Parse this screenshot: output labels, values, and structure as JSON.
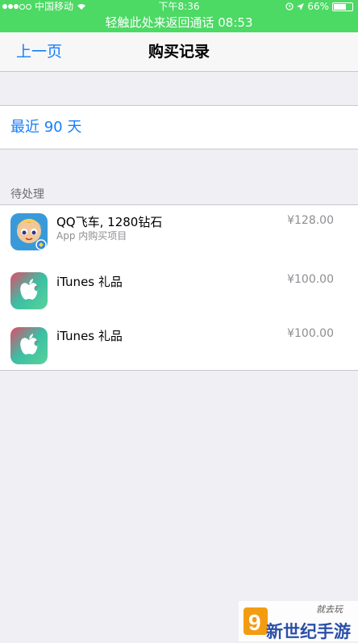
{
  "status_bar": {
    "carrier": "中国移动",
    "time": "下午8:36",
    "battery": "66%",
    "battery_level": 0.66,
    "icons": [
      "signal-dots",
      "wifi-icon",
      "alarm-icon",
      "location-icon",
      "battery-icon"
    ]
  },
  "call_banner": {
    "text": "轻触此处来返回通话 08:53"
  },
  "nav": {
    "back_label": "上一页",
    "title": "购买记录"
  },
  "period": {
    "label": "最近 90 天"
  },
  "pending": {
    "header": "待处理",
    "items": [
      {
        "title": "QQ飞车, 1280钻石",
        "subtitle": "App 内购买项目",
        "price": "¥128.00",
        "icon": "qq-speed-game-icon"
      },
      {
        "title": "iTunes 礼品",
        "subtitle": "",
        "price": "¥100.00",
        "icon": "itunes-gift-icon"
      },
      {
        "title": "iTunes 礼品",
        "subtitle": "",
        "price": "¥100.00",
        "icon": "itunes-gift-icon"
      }
    ]
  },
  "watermark": {
    "text": "新世纪手游",
    "logo_char": "9",
    "signature": "就去玩"
  },
  "colors": {
    "accent": "#157efb",
    "status_green": "#4cd964",
    "background": "#efeff4",
    "secondary_text": "#8e8e93"
  }
}
